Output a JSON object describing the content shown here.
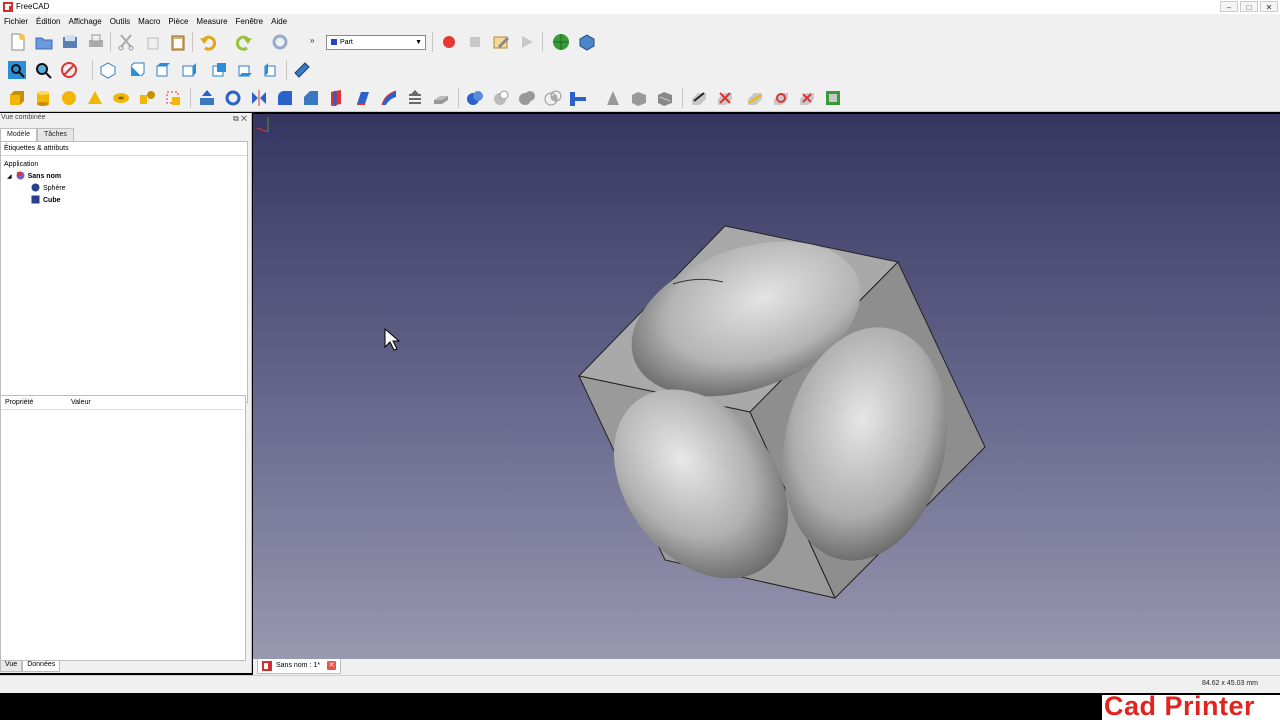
{
  "window": {
    "title": "FreeCAD",
    "controls": [
      "–",
      "□",
      "✕"
    ]
  },
  "menu": [
    "Fichier",
    "Édition",
    "Affichage",
    "Outils",
    "Macro",
    "Pièce",
    "Measure",
    "Fenêtre",
    "Aide"
  ],
  "workbench": {
    "selected": "Part",
    "more": "»"
  },
  "left_panel": {
    "title": "Vue combinée",
    "tabs": [
      "Modèle",
      "Tâches"
    ],
    "tree_header": "Étiquettes & attributs",
    "tree": {
      "root": "Application",
      "document": "Sans nom",
      "children": [
        "Sphère",
        "Cube"
      ]
    },
    "props_columns": [
      "Propriété",
      "Valeur"
    ],
    "bottom_tabs": [
      "Vue",
      "Données"
    ]
  },
  "doc_tab": {
    "label": "Sans nom : 1*"
  },
  "status": {
    "dimensions": "84.62 x 45.03 mm"
  },
  "watermark": "Cad Printer",
  "icons": {
    "toolbar1": [
      "new-icon",
      "open-icon",
      "save-icon",
      "print-icon",
      "cut-icon",
      "copy-icon",
      "paste-icon",
      "undo-icon",
      "redo-icon",
      "refresh-icon",
      "record-macro-icon",
      "stop-macro-icon",
      "edit-macro-icon",
      "run-macro-icon",
      "web-icon",
      "part-design-icon"
    ],
    "toolbar2": [
      "fit-all-icon",
      "fit-selection-icon",
      "draw-style-icon",
      "view-isometric-icon",
      "view-front-icon",
      "view-top-icon",
      "view-right-icon",
      "view-rear-icon",
      "view-bottom-icon",
      "view-left-icon",
      "measure-icon"
    ],
    "toolbar3": [
      "box-icon",
      "cylinder-icon",
      "sphere-icon",
      "cone-icon",
      "torus-icon",
      "primitives-icon",
      "shape-builder-icon",
      "extrude-icon",
      "revolve-icon",
      "mirror-icon",
      "fillet-icon",
      "chamfer-icon",
      "ruled-surface-icon",
      "loft-icon",
      "sweep-icon",
      "section-icon",
      "offset-icon",
      "boolean-icon",
      "cut-icon",
      "fuse-icon",
      "common-icon",
      "join-icon",
      "compound-icon",
      "shape-check-icon",
      "defeaturing-icon",
      "cross-section-icon",
      "measure-linear-icon",
      "measure-angular-icon",
      "measure-refresh-icon",
      "measure-clear-icon",
      "measure-toggle-3d-icon",
      "measure-toggle-delta-icon"
    ]
  },
  "colors": {
    "record": "#e53935",
    "accent": "#2a62c9",
    "watermark": "#e1241f"
  }
}
